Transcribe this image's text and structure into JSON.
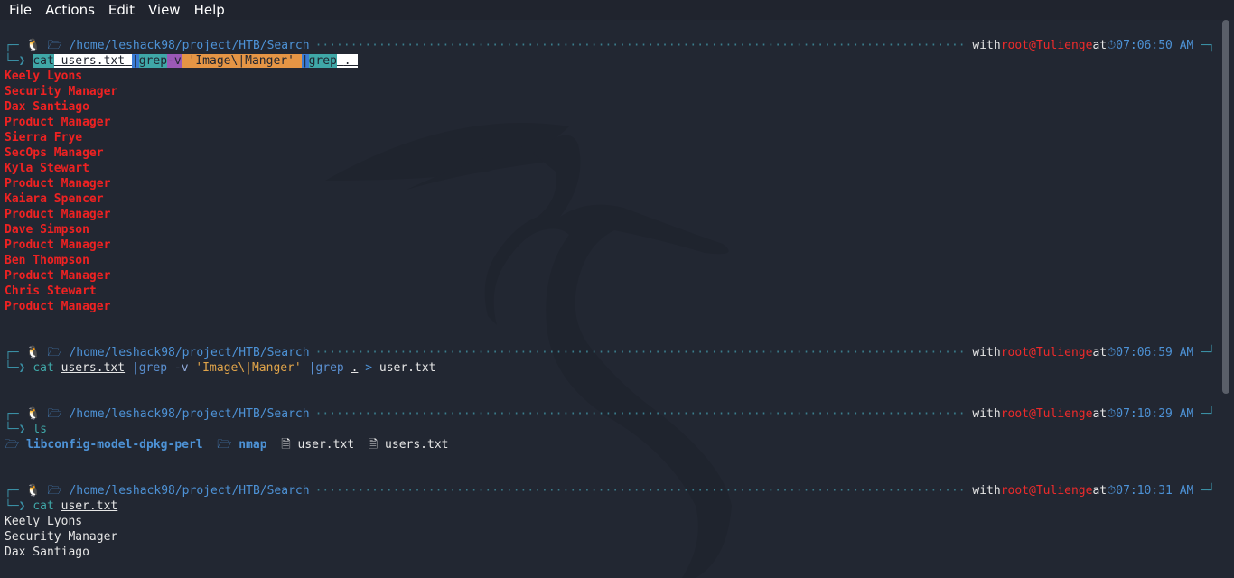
{
  "menu": {
    "file": "File",
    "actions": "Actions",
    "edit": "Edit",
    "view": "View",
    "help": "Help"
  },
  "prompt": {
    "path": "/home/leshack98/project/HTB/Search",
    "with": "with",
    "user": "root@Tulienge",
    "at": "at"
  },
  "blocks": [
    {
      "time": "07:06:50 AM"
    },
    {
      "time": "07:06:59 AM"
    },
    {
      "time": "07:10:29 AM"
    },
    {
      "time": "07:10:31 AM"
    }
  ],
  "cmd1": {
    "cat": "cat",
    "file": "users.txt",
    "pipe1": "|grep",
    "flag": "-v",
    "pattern": "'Image\\|Manger'",
    "pipe2": "|grep",
    "dot": "."
  },
  "output1": [
    "Keely Lyons",
    "Security Manager",
    "Dax Santiago",
    "Product Manager",
    "Sierra Frye",
    "SecOps Manager",
    "Kyla Stewart",
    "Product Manager",
    "Kaiara Spencer",
    "Product Manager",
    "Dave Simpson",
    "Product Manager",
    "Ben Thompson",
    "Product Manager",
    "Chris Stewart",
    "Product Manager"
  ],
  "cmd2": {
    "cat": "cat",
    "file": "users.txt",
    "pipe1": "|grep",
    "flag": "-v",
    "pattern": "'Image\\|Manger'",
    "pipe2": "|grep",
    "dot": ".",
    "redirect": ">",
    "outfile": "user.txt"
  },
  "cmd3": {
    "ls": "ls"
  },
  "ls_output": [
    {
      "name": "libconfig-model-dpkg-perl",
      "type": "dir"
    },
    {
      "name": "nmap",
      "type": "dir"
    },
    {
      "name": "user.txt",
      "type": "file"
    },
    {
      "name": "users.txt",
      "type": "file"
    }
  ],
  "cmd4": {
    "cat": "cat",
    "file": "user.txt"
  },
  "output4": [
    "Keely Lyons",
    "Security Manager",
    "Dax Santiago"
  ]
}
